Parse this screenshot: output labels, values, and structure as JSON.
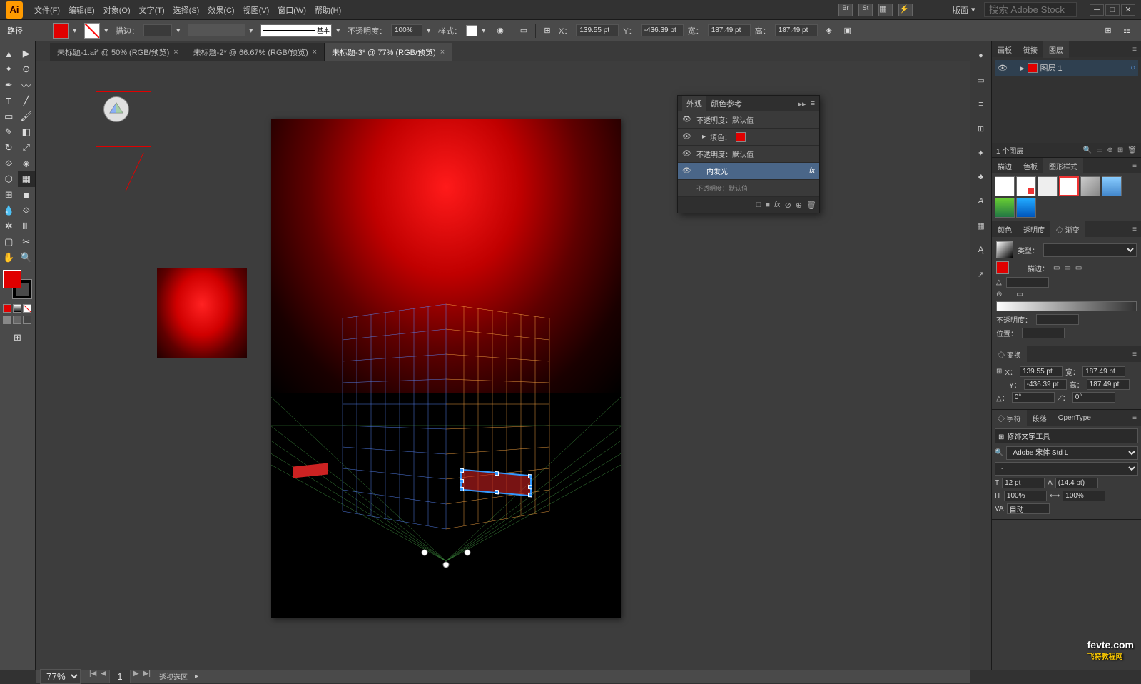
{
  "app": {
    "logo": "Ai"
  },
  "menu": {
    "items": [
      "文件(F)",
      "编辑(E)",
      "对象(O)",
      "文字(T)",
      "选择(S)",
      "效果(C)",
      "视图(V)",
      "窗口(W)",
      "帮助(H)"
    ],
    "workspace": "版面",
    "search_placeholder": "搜索 Adobe Stock"
  },
  "control": {
    "mode": "路径",
    "stroke_label": "描边：",
    "stroke_profile": "基本",
    "opacity_label": "不透明度：",
    "opacity": "100%",
    "style_label": "样式：",
    "x_label": "X：",
    "x": "139.55 pt",
    "y_label": "Y：",
    "y": "-436.39 pt",
    "w_label": "宽：",
    "w": "187.49 pt",
    "h_label": "高：",
    "h": "187.49 pt"
  },
  "tabs": [
    {
      "label": "未标题-1.ai* @ 50% (RGB/预览)",
      "active": false
    },
    {
      "label": "未标题-2* @ 66.67% (RGB/预览)",
      "active": false
    },
    {
      "label": "未标题-3* @ 77% (RGB/预览)",
      "active": true
    }
  ],
  "appearance": {
    "tabs": [
      "外观",
      "颜色参考"
    ],
    "rows": {
      "op1": "不透明度：默认值",
      "fill": "填色：",
      "op2": "不透明度：默认值",
      "inner_glow": "内发光",
      "opdef": "不透明度：默认值"
    }
  },
  "layers": {
    "tabs": [
      "画板",
      "链接",
      "图层"
    ],
    "layer_name": "图层 1",
    "count": "1 个图层"
  },
  "styles": {
    "tabs": [
      "描边",
      "色板",
      "图形样式"
    ]
  },
  "gradient": {
    "tabs": [
      "颜色",
      "透明度",
      "◇ 渐变"
    ],
    "type_label": "类型：",
    "stroke_label": "描边：",
    "angle_label": "△",
    "opacity_label": "不透明度：",
    "position_label": "位置："
  },
  "transform": {
    "label": "◇ 变换",
    "x_label": "X：",
    "x": "139.55 pt",
    "y_label": "Y：",
    "y": "-436.39 pt",
    "w_label": "宽：",
    "w": "187.49 pt",
    "h_label": "高：",
    "h": "187.49 pt",
    "angle_label": "△：",
    "angle": "0°",
    "shear_label": "⟋：",
    "shear": "0°"
  },
  "character": {
    "tabs": [
      "◇ 字符",
      "段落",
      "OpenType"
    ],
    "touch_tool": "修饰文字工具",
    "font": "Adobe 宋体 Std L",
    "style": "-",
    "size_label": "T",
    "size": "12 pt",
    "leading_label": "A",
    "leading": "(14.4 pt)",
    "vscale_label": "IT",
    "vscale": "100%",
    "tracking_label": "VA",
    "tracking": "自动",
    "hscale": "100%"
  },
  "status": {
    "zoom": "77%",
    "page": "1",
    "tool": "透视选区"
  },
  "watermark": {
    "main": "fevte.com",
    "sub": "飞特教程网"
  }
}
